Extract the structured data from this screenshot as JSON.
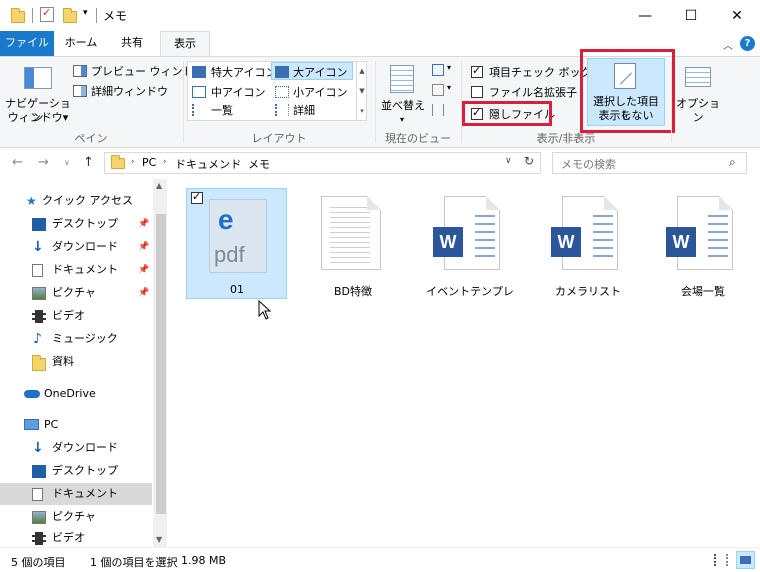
{
  "window": {
    "title": "メモ"
  },
  "tabs": [
    {
      "label": "ファイル"
    },
    {
      "label": "ホーム"
    },
    {
      "label": "共有"
    },
    {
      "label": "表示"
    }
  ],
  "ribbon": {
    "pane_group": {
      "navigation_pane_line1": "ナビゲーション",
      "navigation_pane_line2": "ウィンドウ▾",
      "preview_pane": "プレビュー ウィンドウ",
      "details_pane": "詳細ウィンドウ",
      "label": "ペイン"
    },
    "layout_group": {
      "extra_large_icons": "特大アイコン",
      "large_icons": "大アイコン",
      "medium_icons": "中アイコン",
      "small_icons": "小アイコン",
      "list": "一覧",
      "details": "詳細",
      "label": "レイアウト"
    },
    "current_view_group": {
      "sort_by_line1": "並べ替え",
      "label": "現在のビュー"
    },
    "show_hide_group": {
      "item_checkboxes": "項目チェック ボックス",
      "file_extensions": "ファイル名拡張子",
      "hidden_items": "隠しファイル",
      "hide_selected_line1": "選択した項目を",
      "hide_selected_line2": "表示しない",
      "label": "表示/非表示",
      "item_checkboxes_checked": true,
      "file_extensions_checked": false,
      "hidden_items_checked": true
    },
    "options": "オプション"
  },
  "address": {
    "crumbs": [
      "PC",
      "ドキュメント",
      "メモ"
    ],
    "search_placeholder": "メモの検索"
  },
  "nav": {
    "quick_access": "クイック アクセス",
    "quick_items": [
      {
        "label": "デスクトップ",
        "pinned": true
      },
      {
        "label": "ダウンロード",
        "pinned": true
      },
      {
        "label": "ドキュメント",
        "pinned": true
      },
      {
        "label": "ピクチャ",
        "pinned": true
      },
      {
        "label": "ビデオ",
        "pinned": false
      },
      {
        "label": "ミュージック",
        "pinned": false
      },
      {
        "label": "資料",
        "pinned": false
      }
    ],
    "onedrive": "OneDrive",
    "pc": "PC",
    "pc_items": [
      {
        "label": "ダウンロード"
      },
      {
        "label": "デスクトップ"
      },
      {
        "label": "ドキュメント",
        "selected": true
      },
      {
        "label": "ピクチャ"
      },
      {
        "label": "ビデオ"
      }
    ],
    "pin_glyph": "📌"
  },
  "files": [
    {
      "name": "01",
      "type": "pdf",
      "badge": "pdf",
      "logo": "e",
      "selected": true
    },
    {
      "name": "BD特徴",
      "type": "text"
    },
    {
      "name": "イベントテンプレ",
      "type": "word",
      "badge": "W"
    },
    {
      "name": "カメラリスト",
      "type": "word",
      "badge": "W"
    },
    {
      "name": "会場一覧",
      "type": "word",
      "badge": "W"
    }
  ],
  "status": {
    "item_count": "5 個の項目",
    "selection": "1 個の項目を選択",
    "size": "1.98 MB"
  },
  "colors": {
    "file_tab": "#1979ca",
    "highlight_red": "#d8203a",
    "selection": "#cce8ff",
    "word_blue": "#2b579a"
  }
}
